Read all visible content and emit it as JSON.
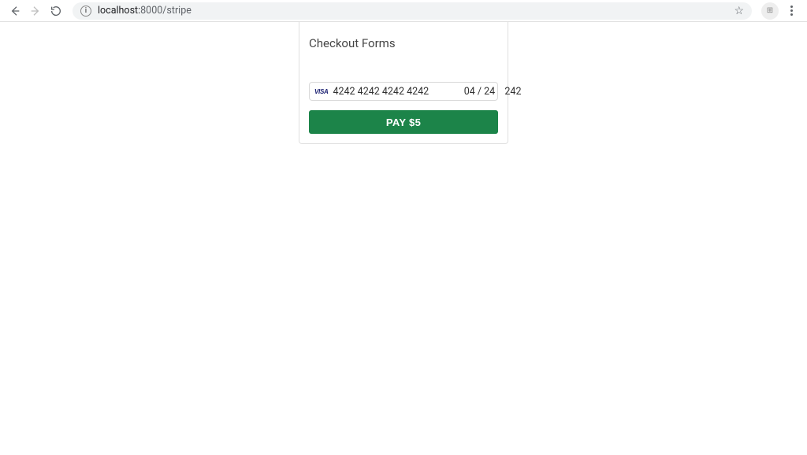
{
  "browser": {
    "url_host": "localhost:",
    "url_port": "8000",
    "url_path": "/stripe"
  },
  "checkout": {
    "title": "Checkout Forms",
    "card_brand": "VISA",
    "card_number": "4242 4242 4242 4242",
    "card_expiry": "04 / 24",
    "card_cvc": "242",
    "pay_button_label": "PAY $5"
  },
  "colors": {
    "button_bg": "#1c8449"
  }
}
